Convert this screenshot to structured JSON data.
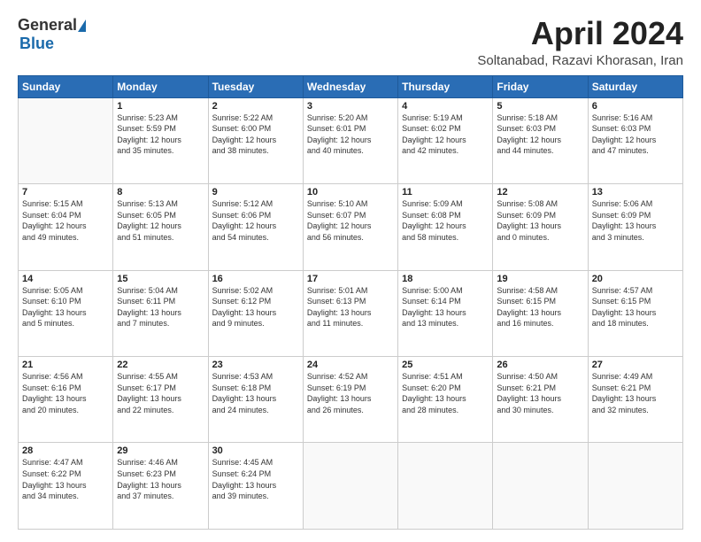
{
  "header": {
    "logo_general": "General",
    "logo_blue": "Blue",
    "month_title": "April 2024",
    "location": "Soltanabad, Razavi Khorasan, Iran"
  },
  "calendar": {
    "headers": [
      "Sunday",
      "Monday",
      "Tuesday",
      "Wednesday",
      "Thursday",
      "Friday",
      "Saturday"
    ],
    "rows": [
      [
        {
          "day": "",
          "info": ""
        },
        {
          "day": "1",
          "info": "Sunrise: 5:23 AM\nSunset: 5:59 PM\nDaylight: 12 hours\nand 35 minutes."
        },
        {
          "day": "2",
          "info": "Sunrise: 5:22 AM\nSunset: 6:00 PM\nDaylight: 12 hours\nand 38 minutes."
        },
        {
          "day": "3",
          "info": "Sunrise: 5:20 AM\nSunset: 6:01 PM\nDaylight: 12 hours\nand 40 minutes."
        },
        {
          "day": "4",
          "info": "Sunrise: 5:19 AM\nSunset: 6:02 PM\nDaylight: 12 hours\nand 42 minutes."
        },
        {
          "day": "5",
          "info": "Sunrise: 5:18 AM\nSunset: 6:03 PM\nDaylight: 12 hours\nand 44 minutes."
        },
        {
          "day": "6",
          "info": "Sunrise: 5:16 AM\nSunset: 6:03 PM\nDaylight: 12 hours\nand 47 minutes."
        }
      ],
      [
        {
          "day": "7",
          "info": "Sunrise: 5:15 AM\nSunset: 6:04 PM\nDaylight: 12 hours\nand 49 minutes."
        },
        {
          "day": "8",
          "info": "Sunrise: 5:13 AM\nSunset: 6:05 PM\nDaylight: 12 hours\nand 51 minutes."
        },
        {
          "day": "9",
          "info": "Sunrise: 5:12 AM\nSunset: 6:06 PM\nDaylight: 12 hours\nand 54 minutes."
        },
        {
          "day": "10",
          "info": "Sunrise: 5:10 AM\nSunset: 6:07 PM\nDaylight: 12 hours\nand 56 minutes."
        },
        {
          "day": "11",
          "info": "Sunrise: 5:09 AM\nSunset: 6:08 PM\nDaylight: 12 hours\nand 58 minutes."
        },
        {
          "day": "12",
          "info": "Sunrise: 5:08 AM\nSunset: 6:09 PM\nDaylight: 13 hours\nand 0 minutes."
        },
        {
          "day": "13",
          "info": "Sunrise: 5:06 AM\nSunset: 6:09 PM\nDaylight: 13 hours\nand 3 minutes."
        }
      ],
      [
        {
          "day": "14",
          "info": "Sunrise: 5:05 AM\nSunset: 6:10 PM\nDaylight: 13 hours\nand 5 minutes."
        },
        {
          "day": "15",
          "info": "Sunrise: 5:04 AM\nSunset: 6:11 PM\nDaylight: 13 hours\nand 7 minutes."
        },
        {
          "day": "16",
          "info": "Sunrise: 5:02 AM\nSunset: 6:12 PM\nDaylight: 13 hours\nand 9 minutes."
        },
        {
          "day": "17",
          "info": "Sunrise: 5:01 AM\nSunset: 6:13 PM\nDaylight: 13 hours\nand 11 minutes."
        },
        {
          "day": "18",
          "info": "Sunrise: 5:00 AM\nSunset: 6:14 PM\nDaylight: 13 hours\nand 13 minutes."
        },
        {
          "day": "19",
          "info": "Sunrise: 4:58 AM\nSunset: 6:15 PM\nDaylight: 13 hours\nand 16 minutes."
        },
        {
          "day": "20",
          "info": "Sunrise: 4:57 AM\nSunset: 6:15 PM\nDaylight: 13 hours\nand 18 minutes."
        }
      ],
      [
        {
          "day": "21",
          "info": "Sunrise: 4:56 AM\nSunset: 6:16 PM\nDaylight: 13 hours\nand 20 minutes."
        },
        {
          "day": "22",
          "info": "Sunrise: 4:55 AM\nSunset: 6:17 PM\nDaylight: 13 hours\nand 22 minutes."
        },
        {
          "day": "23",
          "info": "Sunrise: 4:53 AM\nSunset: 6:18 PM\nDaylight: 13 hours\nand 24 minutes."
        },
        {
          "day": "24",
          "info": "Sunrise: 4:52 AM\nSunset: 6:19 PM\nDaylight: 13 hours\nand 26 minutes."
        },
        {
          "day": "25",
          "info": "Sunrise: 4:51 AM\nSunset: 6:20 PM\nDaylight: 13 hours\nand 28 minutes."
        },
        {
          "day": "26",
          "info": "Sunrise: 4:50 AM\nSunset: 6:21 PM\nDaylight: 13 hours\nand 30 minutes."
        },
        {
          "day": "27",
          "info": "Sunrise: 4:49 AM\nSunset: 6:21 PM\nDaylight: 13 hours\nand 32 minutes."
        }
      ],
      [
        {
          "day": "28",
          "info": "Sunrise: 4:47 AM\nSunset: 6:22 PM\nDaylight: 13 hours\nand 34 minutes."
        },
        {
          "day": "29",
          "info": "Sunrise: 4:46 AM\nSunset: 6:23 PM\nDaylight: 13 hours\nand 37 minutes."
        },
        {
          "day": "30",
          "info": "Sunrise: 4:45 AM\nSunset: 6:24 PM\nDaylight: 13 hours\nand 39 minutes."
        },
        {
          "day": "",
          "info": ""
        },
        {
          "day": "",
          "info": ""
        },
        {
          "day": "",
          "info": ""
        },
        {
          "day": "",
          "info": ""
        }
      ]
    ]
  }
}
